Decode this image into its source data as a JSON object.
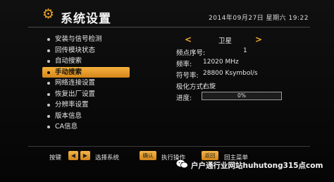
{
  "header": {
    "title": "系统设置",
    "datetime": "2014年09月27日  星期六  19:22"
  },
  "menu": {
    "items": [
      {
        "label": "安装与信号检测",
        "active": false
      },
      {
        "label": "回传模块状态",
        "active": false
      },
      {
        "label": "自动搜索",
        "active": false
      },
      {
        "label": "手动搜索",
        "active": true
      },
      {
        "label": "网络连接设置",
        "active": false
      },
      {
        "label": "恢复出厂设置",
        "active": false
      },
      {
        "label": "分辨率设置",
        "active": false
      },
      {
        "label": "版本信息",
        "active": false
      },
      {
        "label": "CA信息",
        "active": false
      }
    ]
  },
  "panel": {
    "satellite": "卫星",
    "fields": [
      {
        "label": "频点序号:",
        "value": "1"
      },
      {
        "label": "频率:",
        "value": "12020  MHz"
      },
      {
        "label": "符号率:",
        "value": "28800  Ksymbol/s"
      },
      {
        "label": "极化方式:",
        "value": "右旋"
      }
    ],
    "progress_label": "进度:",
    "progress_text": "0%",
    "progress_value": 0
  },
  "footer": {
    "nav_label": "按键",
    "select_system": "选择系统",
    "confirm_key": "确认",
    "execute": "执行操作",
    "back_key": "返回",
    "main_menu": "回主菜单"
  },
  "watermark": "户户通行业网站huhutong315点com",
  "colors": {
    "accent": "#f0a630",
    "background": "#070707"
  },
  "icons": {
    "header": "gear-icon",
    "left": "chevron-left-icon",
    "right": "chevron-right-icon",
    "watermark": "wechat-icon"
  }
}
